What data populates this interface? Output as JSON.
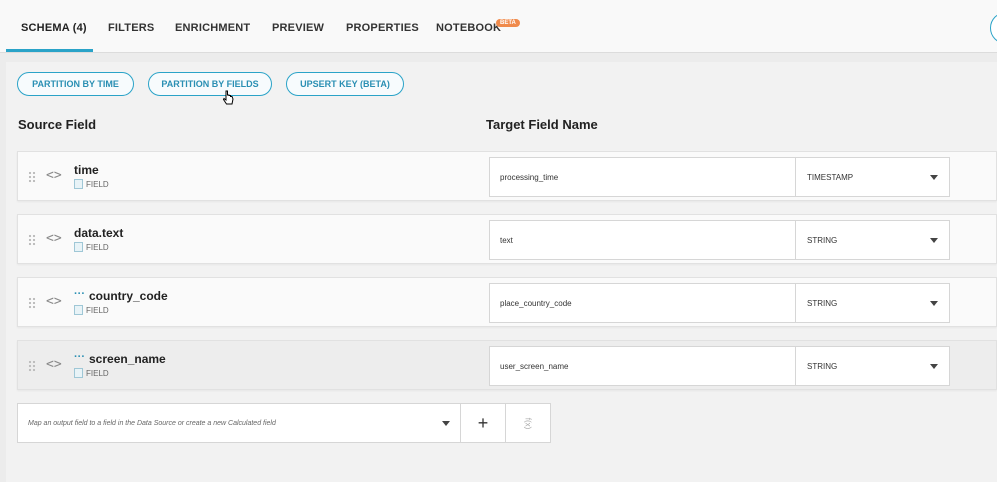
{
  "tabs": [
    {
      "label": "SCHEMA (4)",
      "active": true
    },
    {
      "label": "FILTERS"
    },
    {
      "label": "ENRICHMENT"
    },
    {
      "label": "PREVIEW"
    },
    {
      "label": "PROPERTIES"
    },
    {
      "label": "NOTEBOOK",
      "badge": "BETA"
    }
  ],
  "actions": {
    "partition_time": "PARTITION BY TIME",
    "partition_fields": "PARTITION BY FIELDS",
    "upsert_key": "UPSERT KEY (BETA)"
  },
  "columns": {
    "source": "Source Field",
    "target": "Target Field Name"
  },
  "rows": [
    {
      "source": "time",
      "kind": "FIELD",
      "target": "processing_time",
      "type": "TIMESTAMP",
      "nested": false
    },
    {
      "source": "data.text",
      "kind": "FIELD",
      "target": "text",
      "type": "STRING",
      "nested": false
    },
    {
      "source": "country_code",
      "kind": "FIELD",
      "target": "place_country_code",
      "type": "STRING",
      "nested": true
    },
    {
      "source": "screen_name",
      "kind": "FIELD",
      "target": "user_screen_name",
      "type": "STRING",
      "nested": true
    }
  ],
  "mapping": {
    "placeholder": "Map an output field to a field in the Data Source or create a new Calculated field",
    "add_label": "+",
    "calc_label": "f(x)"
  },
  "colors": {
    "accent": "#2aa3c8",
    "beta_badge": "#f08a4b"
  }
}
